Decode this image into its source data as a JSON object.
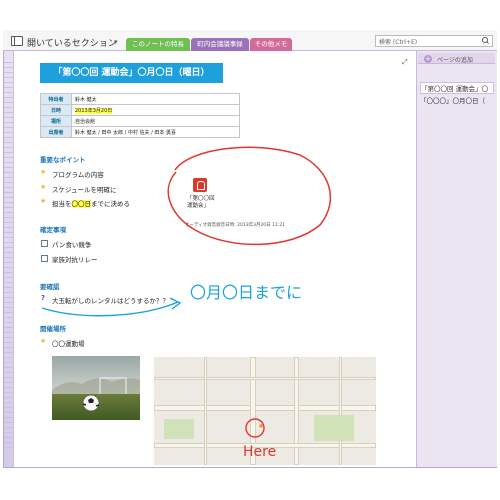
{
  "app": {
    "notebook_title": "開いているセクション",
    "search_placeholder": "検索 (Ctrl+E)"
  },
  "tabs": [
    {
      "label": "このノートの特長",
      "color": "#6fbf52"
    },
    {
      "label": "町内会議議事録",
      "color": "#9a72b8"
    },
    {
      "label": "その他メモ",
      "color": "#d36b9a"
    }
  ],
  "sidebar": {
    "add_page_label": "ページの追加",
    "pages": [
      {
        "label": "「第〇〇回 運動会」〇"
      },
      {
        "label": "「〇〇〇」〇月〇日（"
      }
    ]
  },
  "note": {
    "title": "「第〇〇回 運動会」〇月〇日（曜日）",
    "info": [
      {
        "key": "特出者",
        "value": "鈴木 健太"
      },
      {
        "key": "日時",
        "value": "2013年3月20日",
        "highlight": true
      },
      {
        "key": "場所",
        "value": "自治会館"
      },
      {
        "key": "出席者",
        "value": "鈴木 健太 / 田中 太郎 / 中村 信夫 / 田本 勇喜"
      }
    ],
    "important": {
      "heading": "重要なポイント",
      "items": [
        "プログラムの内容",
        "スケジュールを明確に"
      ],
      "last_prefix": "担当を",
      "last_highlight": "〇〇日",
      "last_suffix": "までに決める"
    },
    "confirmed": {
      "heading": "確定事項",
      "items": [
        "パン食い競争",
        "家族対抗リレー"
      ]
    },
    "to_confirm": {
      "heading": "要確認",
      "item": "大玉転がしのレンタルはどうするか？？"
    },
    "venue": {
      "heading": "開催場所",
      "item": "〇〇運動場"
    },
    "attachment": {
      "label": "「第〇〇回\n運動会」",
      "recording_time": "オーディオ録音録音日時: 2013年3月20日 11:21"
    },
    "ink": {
      "deadline": "〇月〇日までに",
      "here": "Here"
    }
  },
  "colors": {
    "accent": "#1ea0dc",
    "ink_red": "#e2352e",
    "ink_blue": "#1ea0dc",
    "star": "#f2b53c"
  }
}
